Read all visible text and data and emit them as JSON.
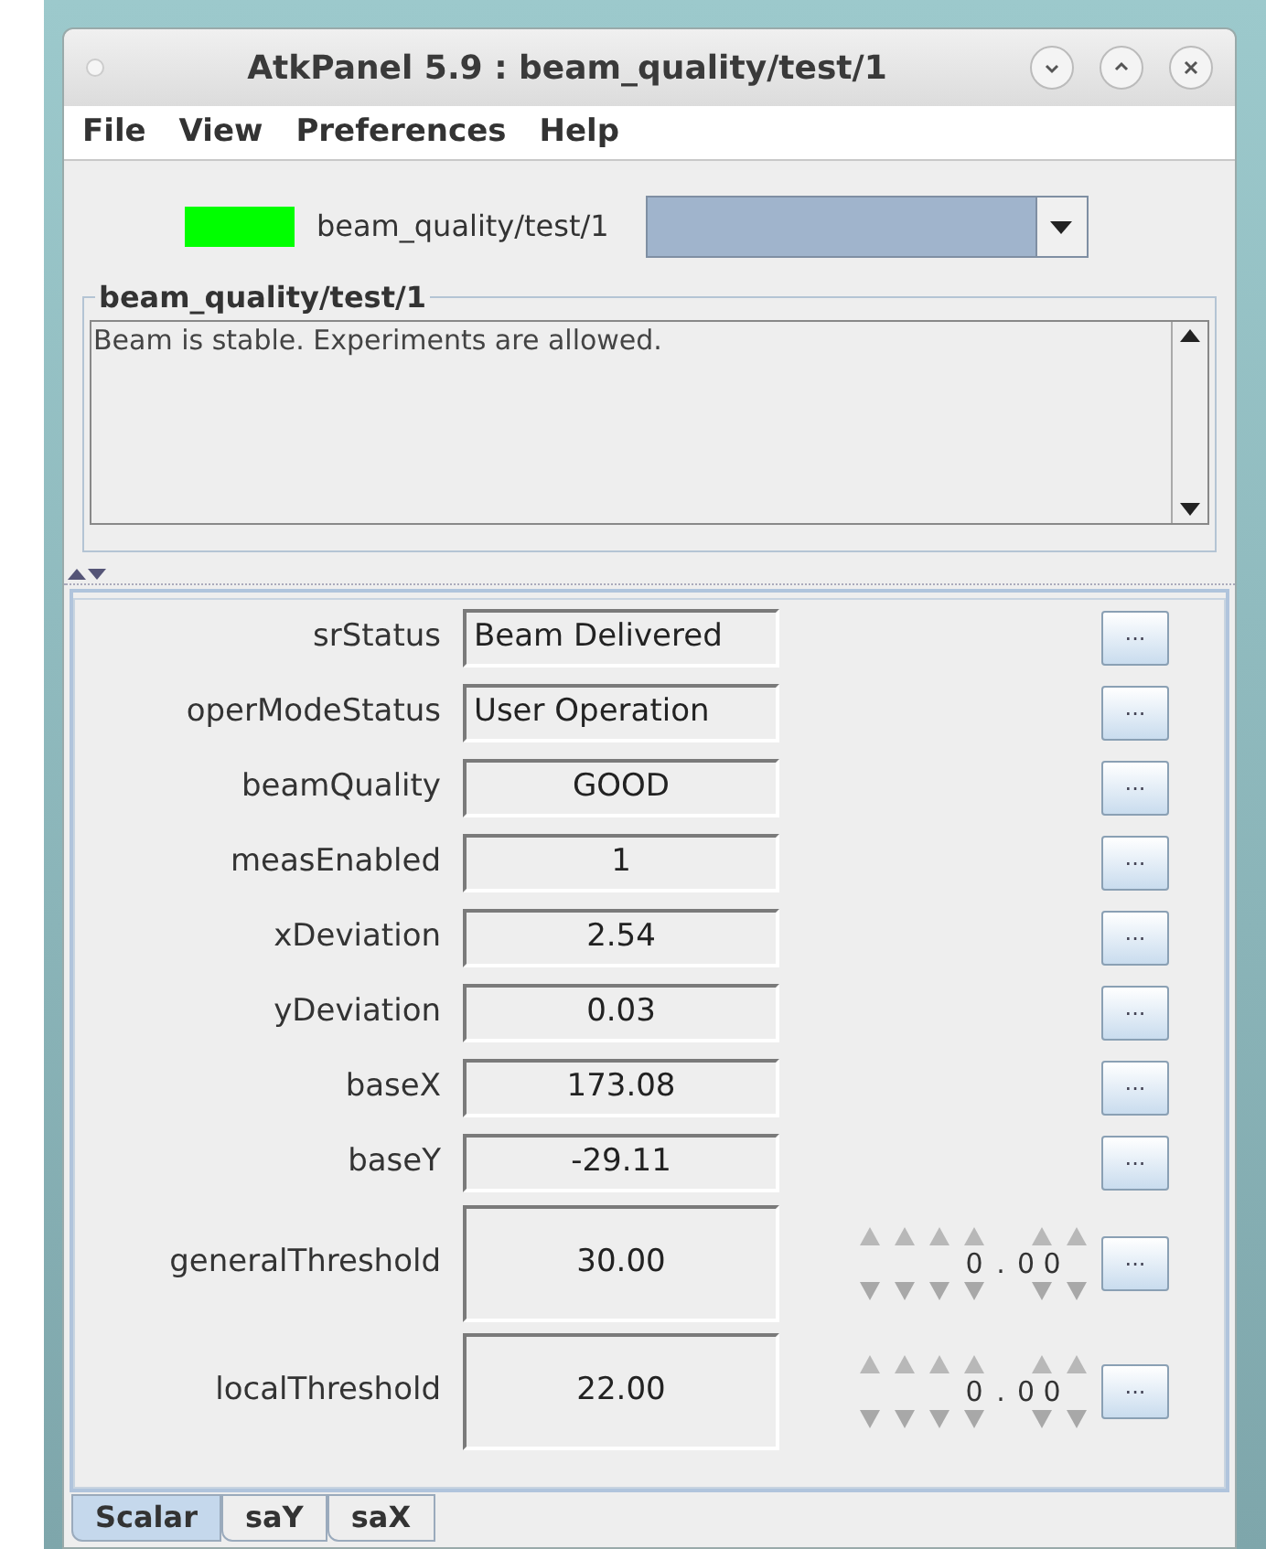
{
  "window": {
    "title": "AtkPanel 5.9 : beam_quality/test/1"
  },
  "menu": [
    "File",
    "View",
    "Preferences",
    "Help"
  ],
  "device": {
    "color": "#00ff00",
    "name": "beam_quality/test/1"
  },
  "status_box": {
    "title": "beam_quality/test/1",
    "text": "Beam is stable. Experiments are allowed."
  },
  "attributes": [
    {
      "kind": "string",
      "label": "srStatus",
      "value": "Beam Delivered",
      "button": "..."
    },
    {
      "kind": "string",
      "label": "operModeStatus",
      "value": "User Operation",
      "button": "..."
    },
    {
      "kind": "number",
      "label": "beamQuality",
      "value": "GOOD",
      "button": "..."
    },
    {
      "kind": "number",
      "label": "measEnabled",
      "value": "1",
      "button": "..."
    },
    {
      "kind": "number",
      "label": "xDeviation",
      "value": "2.54",
      "button": "..."
    },
    {
      "kind": "number",
      "label": "yDeviation",
      "value": "0.03",
      "button": "..."
    },
    {
      "kind": "number",
      "label": "baseX",
      "value": "173.08",
      "button": "..."
    },
    {
      "kind": "number",
      "label": "baseY",
      "value": "-29.11",
      "button": "..."
    },
    {
      "kind": "setpoint",
      "label": "generalThreshold",
      "value": "30.00",
      "wheel": {
        "integer": "0",
        "separator": ".",
        "fraction": "0 0"
      },
      "button": "..."
    },
    {
      "kind": "setpoint",
      "label": "localThreshold",
      "value": "22.00",
      "wheel": {
        "integer": "0",
        "separator": ".",
        "fraction": "0 0"
      },
      "button": "..."
    }
  ],
  "tabs": [
    {
      "label": "Scalar",
      "selected": true
    },
    {
      "label": "saY",
      "selected": false
    },
    {
      "label": "saX",
      "selected": false
    }
  ]
}
